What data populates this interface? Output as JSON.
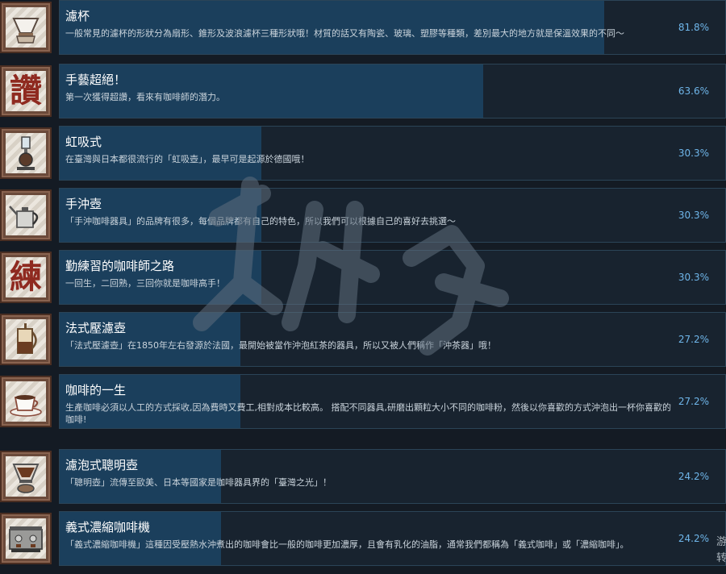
{
  "achievements": [
    {
      "title": "濾杯",
      "desc": "一般常見的濾杯的形狀分為扇形、錐形及波浪濾杯三種形狀哦！材質的話又有陶瓷、玻璃、塑膠等種類，差別最大的地方就是保溫效果的不同～",
      "percent": "81.8%",
      "value": 81.8,
      "icon": "dripper-icon"
    },
    {
      "title": "手藝超絕！",
      "desc": "第一次獲得超讚，看來有咖啡師的潛力。",
      "percent": "63.6%",
      "value": 63.6,
      "icon": "kanji-zan-icon",
      "glyph": "讚"
    },
    {
      "title": "虹吸式",
      "desc": "在臺灣與日本都很流行的「虹吸壺」，最早可是起源於德國哦！",
      "percent": "30.3%",
      "value": 30.3,
      "icon": "siphon-icon"
    },
    {
      "title": "手沖壺",
      "desc": "「手沖咖啡器具」的品牌有很多，每個品牌都有自己的特色，所以我們可以根據自己的喜好去挑選～",
      "percent": "30.3%",
      "value": 30.3,
      "icon": "kettle-icon"
    },
    {
      "title": "勤練習的咖啡師之路",
      "desc": "一回生，二回熟，三回你就是咖啡高手！",
      "percent": "30.3%",
      "value": 30.3,
      "icon": "kanji-lian-icon",
      "glyph": "練"
    },
    {
      "title": "法式壓濾壺",
      "desc": "「法式壓濾壺」在1850年左右發源於法國，最開始被當作沖泡紅茶的器具，所以又被人們稱作「沖茶器」哦！",
      "percent": "27.2%",
      "value": 27.2,
      "icon": "french-press-icon"
    },
    {
      "title": "咖啡的一生",
      "desc": "生產咖啡必須以人工的方式採收,因為費時又費工,相對成本比較高。 搭配不同器具,研磨出顆粒大小不同的咖啡粉，然後以你喜歡的方式沖泡出一杯你喜歡的咖啡!",
      "percent": "27.2%",
      "value": 27.2,
      "icon": "coffee-cup-icon"
    },
    {
      "title": "濾泡式聰明壺",
      "desc": "「聰明壺」流傳至歐美、日本等國家是咖啡器具界的「臺灣之光」！",
      "percent": "24.2%",
      "value": 24.2,
      "icon": "clever-dripper-icon"
    },
    {
      "title": "義式濃縮咖啡機",
      "desc": "「義式濃縮咖啡機」這種因受壓熱水沖煮出的咖啡會比一般的咖啡更加濃厚，且會有乳化的油脂，通常我們都稱為「義式咖啡」或「濃縮咖啡」。",
      "percent": "24.2%",
      "value": 24.2,
      "icon": "espresso-machine-icon"
    }
  ],
  "edge_text": "游转",
  "colors": {
    "bar": "#1b3f5c",
    "panel": "#18232f",
    "percent": "#6fb6ea",
    "background": "#141b24"
  }
}
